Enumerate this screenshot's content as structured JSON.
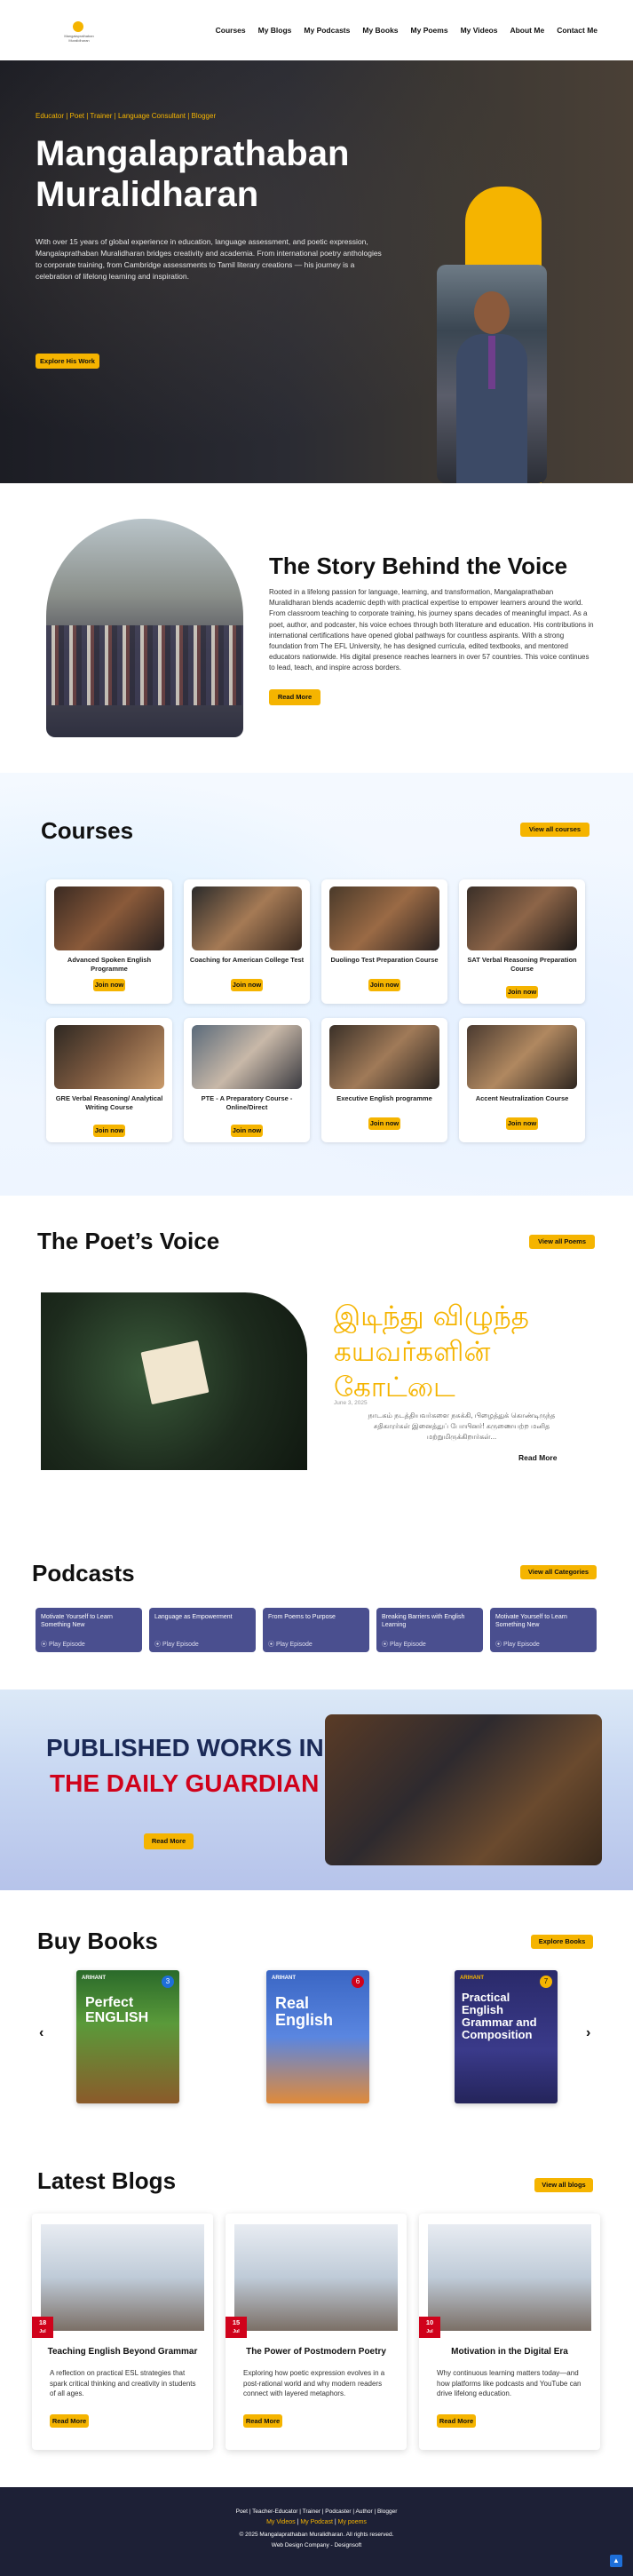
{
  "brand": {
    "logo_text": "Mangalaprathaban Muralidharan"
  },
  "nav": {
    "items": [
      "Courses",
      "My Blogs",
      "My Podcasts",
      "My Books",
      "My Poems",
      "My Videos",
      "About Me",
      "Contact Me"
    ]
  },
  "hero": {
    "tagline": "Educator | Poet | Trainer | Language Consultant | Blogger",
    "title_line1": "Mangalaprathaban",
    "title_line2": "Muralidharan",
    "description": "With over 15 years of global experience in education, language assessment, and poetic expression, Mangalaprathaban Muralidharan bridges creativity and academia. From international poetry anthologies to corporate training, from Cambridge assessments to Tamil literary creations — his journey is a celebration of lifelong learning and inspiration.",
    "cta": "Explore His Work"
  },
  "story": {
    "title": "The Story Behind the Voice",
    "text": "Rooted in a lifelong passion for language, learning, and transformation, Mangalaprathaban Muralidharan blends academic depth with practical expertise to empower learners around the world. From classroom teaching to corporate training, his journey spans decades of meaningful impact. As a poet, author, and podcaster, his voice echoes through both literature and education. His contributions in international certifications have opened global pathways for countless aspirants. With a strong foundation from The EFL University, he has designed curricula, edited textbooks, and mentored educators nationwide. His digital presence reaches learners in over 57 countries. This voice continues to lead, teach, and inspire across borders.",
    "cta": "Read More"
  },
  "courses": {
    "title": "Courses",
    "view_all": "View all courses",
    "button": "Join now",
    "items": [
      "Advanced Spoken English Programme",
      "Coaching for American College Test",
      "Duolingo Test Preparation Course",
      "SAT Verbal Reasoning Preparation Course",
      "GRE Verbal Reasoning/ Analytical Writing Course",
      "PTE - A Preparatory Course - Online/Direct",
      "Executive English programme",
      "Accent Neutralization Course"
    ]
  },
  "poet": {
    "title": "The Poet’s Voice",
    "view_all": "View all Poems",
    "poem_title": "இடிந்து விழுந்த கயவர்களின் கோட்டை",
    "date": "June 3, 2025",
    "excerpt": "நாடகம் நடத்தியவர்களை நசுக்கி, பிழைத்துக் கொண்டிருந்த சதிகாரர்கள் இனைத்துப் போயினர்! கருணையற்ற மனித மற்றுமிருக்கிறார்கள்...",
    "read_more": "Read More"
  },
  "podcasts": {
    "title": "Podcasts",
    "view_all": "View all Categories",
    "play_label": "Play Episode",
    "items": [
      "Motivate Yourself to Learn Something New",
      "Language as Empowerment",
      "From Poems to Purpose",
      "Breaking Barriers with English Learning",
      "Motivate Yourself to Learn Something New"
    ]
  },
  "published": {
    "line1": "PUBLISHED WORKS IN",
    "line2": "THE DAILY GUARDIAN",
    "cta": "Read More"
  },
  "books": {
    "title": "Buy Books",
    "cta": "Explore Books",
    "prev": "‹",
    "next": "›",
    "covers": [
      {
        "publisher": "ARIHANT",
        "title": "Perfect ENGLISH",
        "grade": "3"
      },
      {
        "publisher": "ARIHANT",
        "title": "Real English",
        "grade": "6"
      },
      {
        "publisher": "ARIHANT",
        "title": "Practical English Grammar and Composition",
        "grade": "7"
      }
    ]
  },
  "blogs": {
    "title": "Latest Blogs",
    "view_all": "View all blogs",
    "button": "Read More",
    "items": [
      {
        "day": "18",
        "month": "Jul",
        "title": "Teaching English Beyond Grammar",
        "excerpt": "A reflection on practical ESL strategies that spark critical thinking and creativity in students of all ages."
      },
      {
        "day": "15",
        "month": "Jul",
        "title": "The Power of Postmodern Poetry",
        "excerpt": "Exploring how poetic expression evolves in a post-rational world and why modern readers connect with layered metaphors."
      },
      {
        "day": "10",
        "month": "Jul",
        "title": "Motivation in the Digital Era",
        "excerpt": "Why continuous learning matters today—and how platforms like podcasts and YouTube can drive lifelong education."
      }
    ]
  },
  "footer": {
    "roles": "Poet | Teacher-Educator | Trainer | Podcaster | Author | Blogger",
    "links": [
      "My Videos",
      "My Podcast",
      "My poems"
    ],
    "copyright": "© 2025 Mangalaprathaban Muralidharan. All rights reserved.",
    "credit": "Web Design Company - Designsoft"
  },
  "colors": {
    "accent": "#f5b400",
    "navy": "#1d2036",
    "podcast": "#4a4f8f",
    "red": "#d0021b"
  }
}
